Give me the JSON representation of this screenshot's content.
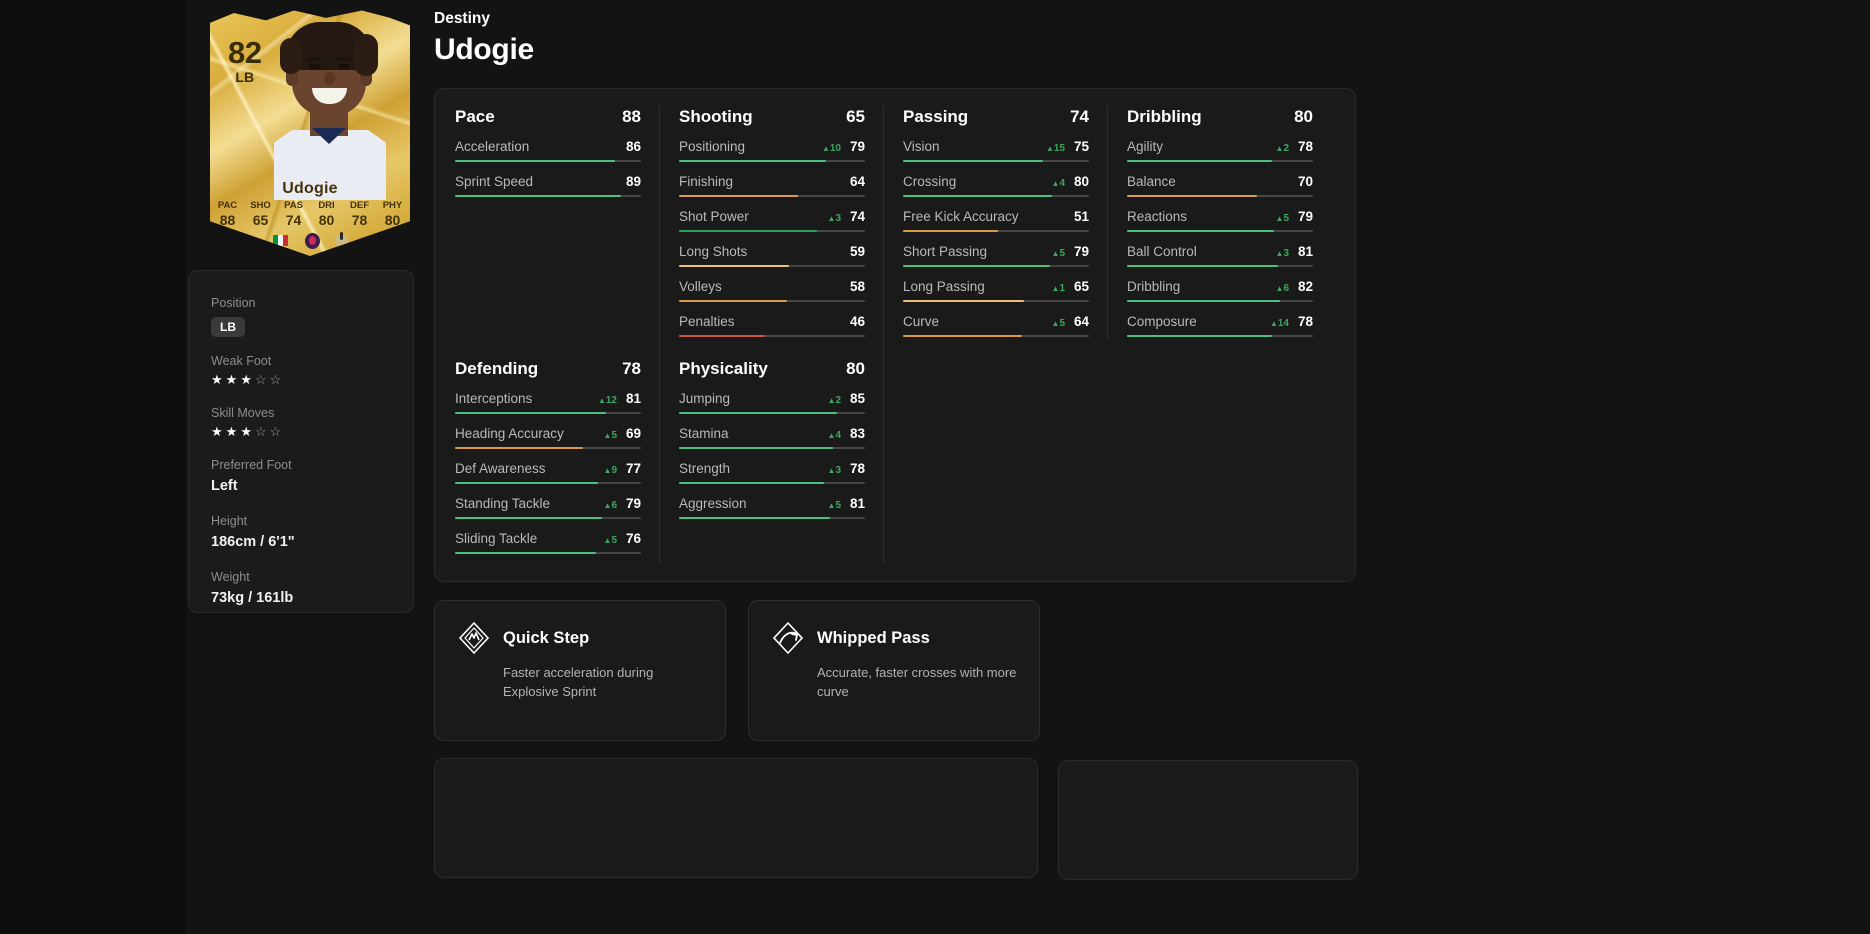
{
  "player": {
    "first_name": "Destiny",
    "last_name": "Udogie",
    "card": {
      "rating": "82",
      "position": "LB",
      "name": "Udogie",
      "stats": [
        {
          "key": "PAC",
          "value": "88"
        },
        {
          "key": "SHO",
          "value": "65"
        },
        {
          "key": "PAS",
          "value": "74"
        },
        {
          "key": "DRI",
          "value": "80"
        },
        {
          "key": "DEF",
          "value": "78"
        },
        {
          "key": "PHY",
          "value": "80"
        }
      ],
      "nation_icon": "italy-flag-icon",
      "league_icon": "premier-league-icon",
      "club_icon": "tottenham-hotspur-icon"
    }
  },
  "info": {
    "position": {
      "label": "Position",
      "value": "LB"
    },
    "weak_foot": {
      "label": "Weak Foot",
      "filled": 3,
      "total": 5
    },
    "skill_moves": {
      "label": "Skill Moves",
      "filled": 3,
      "total": 5
    },
    "preferred_foot": {
      "label": "Preferred Foot",
      "value": "Left"
    },
    "height": {
      "label": "Height",
      "value": "186cm / 6'1\""
    },
    "weight": {
      "label": "Weight",
      "value": "73kg / 161lb"
    }
  },
  "colors": {
    "green": "#4cc07e",
    "dark_green": "#2e9c5a",
    "orange": "#d99a4e",
    "light_orange": "#e9bf7c",
    "red": "#c9543f",
    "track": "#474747",
    "delta_up": "#3aa860"
  },
  "stat_groups": [
    {
      "title": "Pace",
      "total": "88",
      "stats": [
        {
          "name": "Acceleration",
          "value": "86",
          "delta": "",
          "pct": 86,
          "color": "#4cc07e"
        },
        {
          "name": "Sprint Speed",
          "value": "89",
          "delta": "",
          "pct": 89,
          "color": "#4cc07e"
        }
      ]
    },
    {
      "title": "Shooting",
      "total": "65",
      "stats": [
        {
          "name": "Positioning",
          "value": "79",
          "delta": "10",
          "pct": 79,
          "color": "#4cc07e"
        },
        {
          "name": "Finishing",
          "value": "64",
          "delta": "",
          "pct": 64,
          "color": "#d99a4e"
        },
        {
          "name": "Shot Power",
          "value": "74",
          "delta": "3",
          "pct": 74,
          "color": "#2e9c5a"
        },
        {
          "name": "Long Shots",
          "value": "59",
          "delta": "",
          "pct": 59,
          "color": "#e9bf7c"
        },
        {
          "name": "Volleys",
          "value": "58",
          "delta": "",
          "pct": 58,
          "color": "#d99a4e"
        },
        {
          "name": "Penalties",
          "value": "46",
          "delta": "",
          "pct": 46,
          "color": "#c9543f"
        }
      ]
    },
    {
      "title": "Passing",
      "total": "74",
      "stats": [
        {
          "name": "Vision",
          "value": "75",
          "delta": "15",
          "pct": 75,
          "color": "#4cc07e"
        },
        {
          "name": "Crossing",
          "value": "80",
          "delta": "4",
          "pct": 80,
          "color": "#4cc07e"
        },
        {
          "name": "Free Kick Accuracy",
          "value": "51",
          "delta": "",
          "pct": 51,
          "color": "#d99a4e"
        },
        {
          "name": "Short Passing",
          "value": "79",
          "delta": "5",
          "pct": 79,
          "color": "#4cc07e"
        },
        {
          "name": "Long Passing",
          "value": "65",
          "delta": "1",
          "pct": 65,
          "color": "#e9bf7c"
        },
        {
          "name": "Curve",
          "value": "64",
          "delta": "5",
          "pct": 64,
          "color": "#d99a4e"
        }
      ]
    },
    {
      "title": "Dribbling",
      "total": "80",
      "stats": [
        {
          "name": "Agility",
          "value": "78",
          "delta": "2",
          "pct": 78,
          "color": "#4cc07e"
        },
        {
          "name": "Balance",
          "value": "70",
          "delta": "",
          "pct": 70,
          "color": "#d99a4e"
        },
        {
          "name": "Reactions",
          "value": "79",
          "delta": "5",
          "pct": 79,
          "color": "#4cc07e"
        },
        {
          "name": "Ball Control",
          "value": "81",
          "delta": "3",
          "pct": 81,
          "color": "#4cc07e"
        },
        {
          "name": "Dribbling",
          "value": "82",
          "delta": "6",
          "pct": 82,
          "color": "#4cc07e"
        },
        {
          "name": "Composure",
          "value": "78",
          "delta": "14",
          "pct": 78,
          "color": "#4cc07e"
        }
      ]
    },
    {
      "title": "Defending",
      "total": "78",
      "stats": [
        {
          "name": "Interceptions",
          "value": "81",
          "delta": "12",
          "pct": 81,
          "color": "#4cc07e"
        },
        {
          "name": "Heading Accuracy",
          "value": "69",
          "delta": "5",
          "pct": 69,
          "color": "#d99a4e"
        },
        {
          "name": "Def Awareness",
          "value": "77",
          "delta": "9",
          "pct": 77,
          "color": "#4cc07e"
        },
        {
          "name": "Standing Tackle",
          "value": "79",
          "delta": "6",
          "pct": 79,
          "color": "#4cc07e"
        },
        {
          "name": "Sliding Tackle",
          "value": "76",
          "delta": "5",
          "pct": 76,
          "color": "#4cc07e"
        }
      ]
    },
    {
      "title": "Physicality",
      "total": "80",
      "stats": [
        {
          "name": "Jumping",
          "value": "85",
          "delta": "2",
          "pct": 85,
          "color": "#4cc07e"
        },
        {
          "name": "Stamina",
          "value": "83",
          "delta": "4",
          "pct": 83,
          "color": "#4cc07e"
        },
        {
          "name": "Strength",
          "value": "78",
          "delta": "3",
          "pct": 78,
          "color": "#4cc07e"
        },
        {
          "name": "Aggression",
          "value": "81",
          "delta": "5",
          "pct": 81,
          "color": "#4cc07e"
        }
      ]
    }
  ],
  "playstyles": [
    {
      "title": "Quick Step",
      "description": "Faster acceleration during Explosive Sprint",
      "icon": "quick-step-icon"
    },
    {
      "title": "Whipped Pass",
      "description": "Accurate, faster crosses with more curve",
      "icon": "whipped-pass-icon"
    }
  ]
}
